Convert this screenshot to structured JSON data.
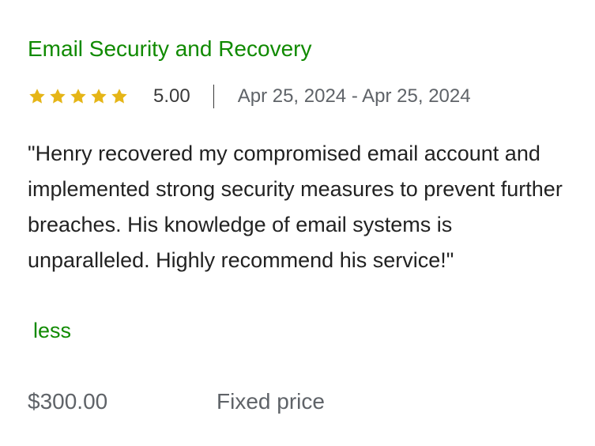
{
  "job": {
    "title": "Email Security and Recovery",
    "rating": {
      "stars_filled": 5,
      "stars_total": 5,
      "score": "5.00",
      "star_color": "#e5b517"
    },
    "dates": "Apr 25, 2024 - Apr 25, 2024",
    "review": "\"Henry recovered my compromised email account and implemented strong security measures to prevent further breaches. His knowledge of email systems is unparalleled. Highly recommend his service!\"",
    "less_label": "less",
    "price": "$300.00",
    "price_type": "Fixed price"
  },
  "colors": {
    "accent_green": "#108a00",
    "text_dark": "#222222",
    "text_muted": "#5f6368"
  }
}
